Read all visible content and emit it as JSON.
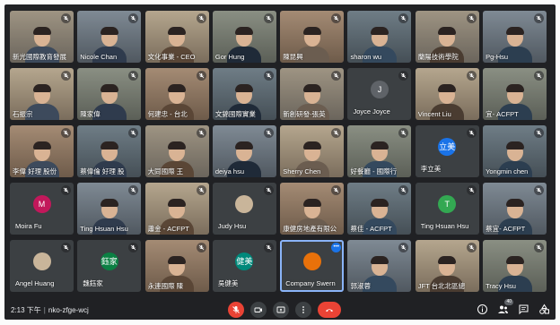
{
  "meeting": {
    "time": "2:13 下午",
    "code": "nko-zfge-wcj",
    "participant_count": "40"
  },
  "colors": {
    "background": "#202124",
    "tile": "#3c4043",
    "end_call": "#ea4335",
    "speaking": "#1a73e8"
  },
  "tiles": [
    {
      "name": "新光國際教育發展",
      "type": "video",
      "muted": true
    },
    {
      "name": "Nicole Chan",
      "type": "video",
      "muted": true
    },
    {
      "name": "文化事業 - CEO",
      "type": "video",
      "muted": true
    },
    {
      "name": "Gor Hung",
      "type": "video",
      "muted": true
    },
    {
      "name": "陳昆興",
      "type": "video",
      "muted": true
    },
    {
      "name": "sharon wu",
      "type": "video",
      "muted": true
    },
    {
      "name": "蘭陽技術學院",
      "type": "video",
      "muted": true
    },
    {
      "name": "Pg-Hsu",
      "type": "video",
      "muted": true
    },
    {
      "name": "石振宗",
      "type": "video",
      "muted": true
    },
    {
      "name": "陳家偉",
      "type": "video",
      "muted": true
    },
    {
      "name": "何建忠 - 台北",
      "type": "video",
      "muted": true
    },
    {
      "name": "文錦國際實業",
      "type": "video",
      "muted": true
    },
    {
      "name": "新創研發-張英",
      "type": "video",
      "muted": true
    },
    {
      "name": "Joyce Joyce",
      "type": "avatar",
      "initial": "J",
      "color": "#5f6368",
      "muted": true
    },
    {
      "name": "Vincent Liu",
      "type": "video",
      "muted": true
    },
    {
      "name": "宜- ACFPT",
      "type": "video",
      "muted": true
    },
    {
      "name": "李偉 好理 股份",
      "type": "video",
      "muted": true
    },
    {
      "name": "蔡偉倫 好理 股",
      "type": "video",
      "muted": true
    },
    {
      "name": "大同國際 王",
      "type": "video",
      "muted": true
    },
    {
      "name": "deiya hsu",
      "type": "video",
      "muted": true
    },
    {
      "name": "Sherry Chen",
      "type": "video",
      "muted": true
    },
    {
      "name": "好餐廳 - 國際行",
      "type": "video",
      "muted": true
    },
    {
      "name": "李立美",
      "type": "avatar",
      "initial": "立美",
      "color": "#1a73e8",
      "muted": true
    },
    {
      "name": "Yongmin chen",
      "type": "video",
      "muted": true
    },
    {
      "name": "Moira Fu",
      "type": "avatar",
      "initial": "M",
      "color": "#c2185b",
      "muted": true
    },
    {
      "name": "Ting Hsuan Hsu",
      "type": "video",
      "muted": true
    },
    {
      "name": "蕭金 - ACFPT",
      "type": "video",
      "muted": true
    },
    {
      "name": "Judy Hsu",
      "type": "avatar",
      "initial": "",
      "color": "photo",
      "muted": true
    },
    {
      "name": "康健房地產有限公",
      "type": "video",
      "muted": true
    },
    {
      "name": "蔡佳 - ACFPT",
      "type": "video",
      "muted": true
    },
    {
      "name": "Ting Hsuan Hsu",
      "type": "avatar",
      "initial": "T",
      "color": "#33a852",
      "muted": true
    },
    {
      "name": "蔡宜- ACFPT",
      "type": "video",
      "muted": true
    },
    {
      "name": "Angel Huang",
      "type": "avatar",
      "initial": "",
      "color": "photo",
      "muted": true
    },
    {
      "name": "魏鈺家",
      "type": "avatar",
      "initial": "鈺家",
      "color": "#0b8043",
      "muted": true
    },
    {
      "name": "永連國際 陳",
      "type": "video",
      "muted": true
    },
    {
      "name": "吳健美",
      "type": "avatar",
      "initial": "健美",
      "color": "#00897b",
      "muted": true
    },
    {
      "name": "Company Swern",
      "type": "avatar",
      "initial": "",
      "color": "#e8710a",
      "muted": false,
      "speaking": true
    },
    {
      "name": "郭淑蓉",
      "type": "video",
      "muted": true
    },
    {
      "name": "JFT 台北北區總",
      "type": "video",
      "muted": true
    },
    {
      "name": "Tracy Hsu",
      "type": "video",
      "muted": true
    }
  ]
}
